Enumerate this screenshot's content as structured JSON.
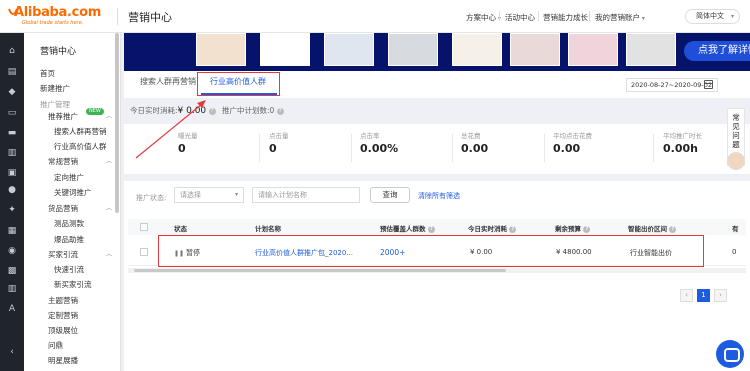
{
  "header": {
    "logo_text": "Alibaba.com",
    "logo_tagline": "Global trade starts here.",
    "title": "营销中心",
    "nav": [
      {
        "label": "方案中心",
        "has_caret": true
      },
      {
        "label": "活动中心",
        "has_caret": false
      },
      {
        "label": "营销能力成长",
        "has_caret": false
      },
      {
        "label": "我的营销账户",
        "has_caret": true
      }
    ],
    "language": "简体中文"
  },
  "sidebar": {
    "title": "营销中心",
    "items": [
      {
        "label": "首页",
        "level": 1
      },
      {
        "label": "新建推广",
        "level": 1
      },
      {
        "label": "推广管理",
        "level": 1,
        "muted": true
      },
      {
        "label": "推荐推广",
        "level": 2,
        "badge": "NEW"
      },
      {
        "label": "搜索人群再营销",
        "level": 3
      },
      {
        "label": "行业高价值人群",
        "level": 3
      },
      {
        "label": "常规营销",
        "level": 2
      },
      {
        "label": "定向推广",
        "level": 3
      },
      {
        "label": "关键词推广",
        "level": 3
      },
      {
        "label": "货品营销",
        "level": 2
      },
      {
        "label": "测品测款",
        "level": 3
      },
      {
        "label": "爆品助推",
        "level": 3
      },
      {
        "label": "买家引流",
        "level": 2
      },
      {
        "label": "快速引流",
        "level": 3
      },
      {
        "label": "新买家引流",
        "level": 3
      },
      {
        "label": "主题营销",
        "level": 2
      },
      {
        "label": "定制营销",
        "level": 2
      },
      {
        "label": "顶级展位",
        "level": 2
      },
      {
        "label": "问鼎",
        "level": 2
      },
      {
        "label": "明星展播",
        "level": 2
      }
    ]
  },
  "banner": {
    "cta": "点我了解详情"
  },
  "tabs": [
    {
      "label": "搜索人群再营销",
      "active": false
    },
    {
      "label": "行业高价值人群",
      "active": true
    }
  ],
  "date_range": "2020-08-27~2020-09-02",
  "summary": {
    "today_spend_label": "今日实时消耗:",
    "today_spend_value": "¥ 0.00",
    "in_progress_label": "推广中计划数:",
    "in_progress_value": "0"
  },
  "stats": [
    {
      "label": "曝光量",
      "value": "0"
    },
    {
      "label": "点击量",
      "value": "0"
    },
    {
      "label": "点击率",
      "value": "0.00%"
    },
    {
      "label": "总花费",
      "value": "0.00"
    },
    {
      "label": "平均点击花费",
      "value": "0.00"
    },
    {
      "label": "平均推广时长",
      "value": "0.00h"
    }
  ],
  "floating_help": "常见问题",
  "filters": {
    "status_label": "推广状态:",
    "status_placeholder": "请选择",
    "name_placeholder": "请输入计划名称",
    "query_button": "查询",
    "clear_link": "清除所有筛选"
  },
  "table": {
    "columns": [
      "状态",
      "计划名称",
      "预估覆盖人群数",
      "今日实时消耗",
      "剩余预算",
      "智能出价区间",
      "有"
    ],
    "rows": [
      {
        "status": "暂停",
        "name": "行业高价值人群推广包_2020...",
        "audience": "2000+",
        "spend": "¥ 0.00",
        "budget": "¥ 4800.00",
        "bid_range": "行业智能出价",
        "extra": "0"
      }
    ]
  },
  "pagination": {
    "prev": "‹",
    "current": "1",
    "next": "›"
  }
}
